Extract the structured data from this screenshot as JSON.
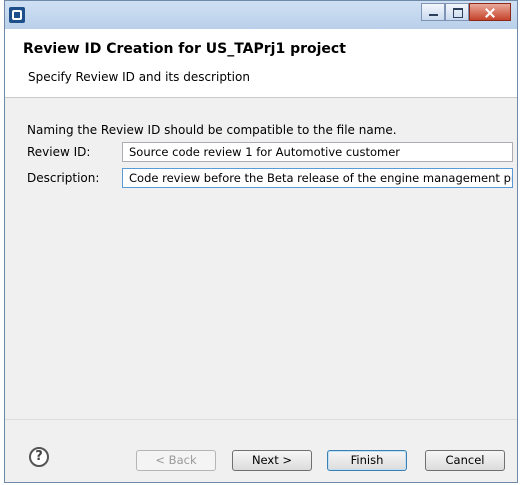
{
  "window": {
    "title": ""
  },
  "header": {
    "title": "Review ID Creation for US_TAPrj1 project",
    "subtitle": "Specify Review ID and its description"
  },
  "form": {
    "hint": "Naming the Review ID should be compatible to the file name.",
    "review_id_label": "Review ID:",
    "review_id_value": "Source code review 1 for Automotive customer",
    "description_label": "Description:",
    "description_value": "Code review before the Beta release of the engine management project"
  },
  "footer": {
    "help_glyph": "?",
    "back_label": "< Back",
    "next_label": "Next >",
    "finish_label": "Finish",
    "cancel_label": "Cancel"
  },
  "icons": [
    "app-icon",
    "minimize-icon",
    "maximize-icon",
    "close-icon",
    "help-icon"
  ]
}
